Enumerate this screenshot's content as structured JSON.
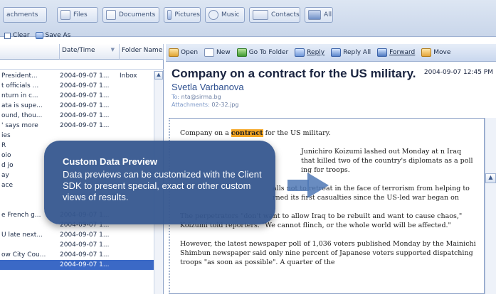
{
  "tabs": [
    {
      "label": "achments"
    },
    {
      "label": "Files"
    },
    {
      "label": "Documents"
    },
    {
      "label": "Pictures"
    },
    {
      "label": "Music"
    },
    {
      "label": "Contacts"
    },
    {
      "label": "All"
    }
  ],
  "subtoolbar": {
    "clear_label": "Clear",
    "saveas_label": "Save As"
  },
  "list": {
    "columns": [
      "Date/Time",
      "Folder Name"
    ],
    "rows": [
      {
        "subject": "President...",
        "date": "2004-09-07 1...",
        "folder": "Inbox"
      },
      {
        "subject": "t officials ...",
        "date": "2004-09-07 1...",
        "folder": ""
      },
      {
        "subject": "nturn in c...",
        "date": "2004-09-07 1...",
        "folder": ""
      },
      {
        "subject": "ata is supe...",
        "date": "2004-09-07 1...",
        "folder": ""
      },
      {
        "subject": "ound, thou...",
        "date": "2004-09-07 1...",
        "folder": ""
      },
      {
        "subject": "' says more",
        "date": "2004-09-07 1...",
        "folder": ""
      },
      {
        "subject": "ies",
        "date": "",
        "folder": ""
      },
      {
        "subject": "R",
        "date": "",
        "folder": ""
      },
      {
        "subject": "oio",
        "date": "",
        "folder": ""
      },
      {
        "subject": "d jo",
        "date": "",
        "folder": ""
      },
      {
        "subject": "ay",
        "date": "",
        "folder": ""
      },
      {
        "subject": "ace",
        "date": "",
        "folder": ""
      },
      {
        "subject": "",
        "date": "",
        "folder": ""
      },
      {
        "subject": "",
        "date": "",
        "folder": ""
      },
      {
        "subject": "e French g...",
        "date": "2004-09-07 1...",
        "folder": ""
      },
      {
        "subject": "",
        "date": "2004-09-07 1...",
        "folder": ""
      },
      {
        "subject": "U late next...",
        "date": "2004-09-07 1...",
        "folder": ""
      },
      {
        "subject": "",
        "date": "2004-09-07 1...",
        "folder": ""
      },
      {
        "subject": "ow City Cou...",
        "date": "2004-09-07 1...",
        "folder": ""
      },
      {
        "subject": "",
        "date": "2004-09-07 1...",
        "folder": "",
        "selected": true
      }
    ]
  },
  "preview_toolbar": {
    "open": "Open",
    "new": "New",
    "goto": "Go To Folder",
    "reply": "Reply",
    "reply_all": "Reply All",
    "forward": "Forward",
    "move": "Move"
  },
  "mail": {
    "subject": "Company on a contract for the US military.",
    "date": "2004-09-07 12:45 PM",
    "sender": "Svetla Varbanova",
    "to_label": "To:",
    "to": "nta@sirma.bg",
    "attachments_label": "Attachments:",
    "attachments": "02-32.jpg",
    "body": {
      "line1_pre": "Company on a ",
      "line1_hl": "contract",
      "line1_post": " for the US military.",
      "p2": "Junichiro Koizumi lashed out Monday at n Iraq that killed two of the country's diplomats as a poll ing for troops.",
      "p3": "alls not to retreat in the face of terrorism from helping to rned its first casualties since the US-led war began on",
      "p4": "The perpetrators \"don't want to allow Iraq to be rebuilt and want to cause chaos,\" Koizumi told reporters. \"We cannot flinch, or the whole world will be affected.\"",
      "p5": "However, the latest newspaper poll of 1,036 voters published Monday by the Mainichi Shimbun newspaper said only nine percent of Japanese voters supported dispatching troops \"as soon as possible\". A quarter of the"
    }
  },
  "callout": {
    "title": "Custom Data Preview",
    "desc": "Data previews can be customized with the Client SDK to present special, exact or other custom views of results."
  },
  "colors": {
    "accent": "#36578f",
    "selection": "#3b69c6",
    "highlight": "#f5a623"
  }
}
